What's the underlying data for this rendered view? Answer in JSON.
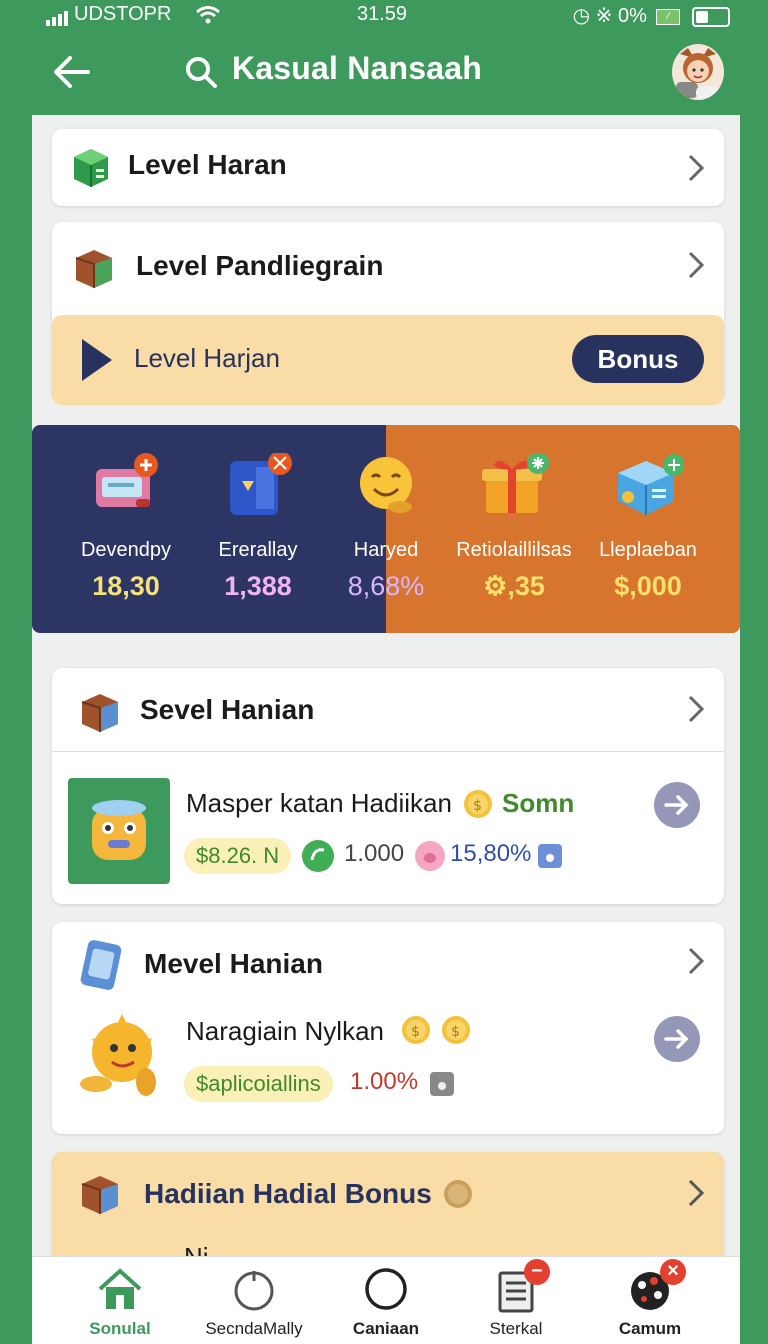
{
  "status_bar": {
    "carrier": "UDSTOPR",
    "time": "31.59",
    "battery_text": "0%"
  },
  "header": {
    "title": "Kasual Nansaah"
  },
  "menu": [
    {
      "label": "Level Haran"
    },
    {
      "label": "Level Pandliegrain"
    }
  ],
  "promo": {
    "label": "Level Harjan",
    "button": "Bonus"
  },
  "stats": [
    {
      "label": "Devendpy",
      "value": "18,30",
      "color": "#f5e27a",
      "icon": "card-icon"
    },
    {
      "label": "Ererallay",
      "value": "1,388",
      "color": "#f0b4f0",
      "icon": "box-icon"
    },
    {
      "label": "Haryed",
      "value": "8,68%",
      "color": "#d6b7ff",
      "icon": "smiley-icon"
    },
    {
      "label": "Retiolaillilsas",
      "value": "⚙,35",
      "color": "#ffe06a",
      "icon": "gift-icon"
    },
    {
      "label": "Lleplaeban",
      "value": "$,000",
      "color": "#ffe06a",
      "icon": "cube-icon"
    }
  ],
  "section1": {
    "title": "Sevel Hanian",
    "item": {
      "title": "Masper katan Hadiikan",
      "tag": "Somn",
      "price": "$8.26. N",
      "count": "1.000",
      "percent": "15,80%"
    }
  },
  "section2": {
    "title": "Mevel Hanian",
    "item": {
      "title": "Naragiain Nylkan",
      "pill": "$aplicoiallins",
      "percent": "1.00%"
    }
  },
  "section3": {
    "title": "Hadiian Hadial Bonus",
    "partial": "Ni"
  },
  "nav": [
    {
      "label": "Sonulal",
      "active": true
    },
    {
      "label": "SecndaMally"
    },
    {
      "label": "Caniaan"
    },
    {
      "label": "Sterkal"
    },
    {
      "label": "Camum"
    }
  ],
  "colors": {
    "brand": "#3e9a5c",
    "navy": "#2d3565",
    "orange": "#d7742d",
    "cream": "#f9dca6"
  }
}
